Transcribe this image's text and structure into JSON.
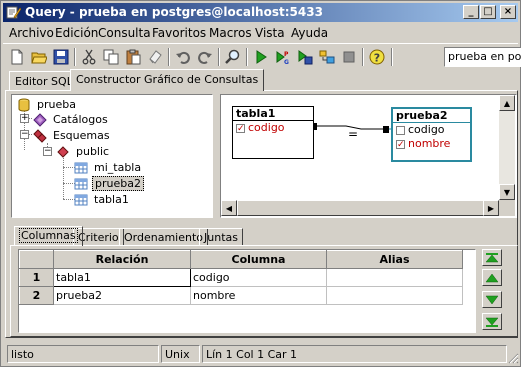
{
  "window": {
    "title": "Query - prueba en postgres@localhost:5433",
    "buttons": {
      "minimize": "_",
      "maximize": "□",
      "close": "×"
    }
  },
  "menu": [
    {
      "label": "Archivo",
      "hotkey": "A"
    },
    {
      "label": "Edición",
      "hotkey": "E"
    },
    {
      "label": "Consulta",
      "hotkey": "C"
    },
    {
      "label": "Favoritos",
      "hotkey": "F"
    },
    {
      "label": "Macros",
      "hotkey": "M"
    },
    {
      "label": "Vista",
      "hotkey": "V"
    },
    {
      "label": "Ayuda",
      "hotkey": "A"
    }
  ],
  "toolbar": {
    "icons": [
      "new-file-icon",
      "open-folder-icon",
      "save-icon",
      "cut-icon",
      "copy-icon",
      "paste-icon",
      "clear-icon",
      "undo-icon",
      "redo-icon",
      "find-icon",
      "execute-icon",
      "explain-icon",
      "execute-to-file-icon",
      "vacuum-icon",
      "stop-icon",
      "help-icon"
    ],
    "database_select": "prueba en post"
  },
  "main_tabs": [
    {
      "label": "Editor SQL",
      "active": false
    },
    {
      "label": "Constructor Gráfico de Consultas",
      "active": true
    }
  ],
  "tree": {
    "root": "prueba",
    "catalogs": "Catálogos",
    "schemas": "Esquemas",
    "schema": "public",
    "tables": [
      "mi_tabla",
      "prueba2",
      "tabla1"
    ],
    "selected": "prueba2"
  },
  "diagram": {
    "tables": [
      {
        "name": "tabla1",
        "fields": [
          {
            "name": "codigo",
            "checked": true
          }
        ]
      },
      {
        "name": "prueba2",
        "fields": [
          {
            "name": "codigo",
            "checked": false
          },
          {
            "name": "nombre",
            "checked": true
          }
        ]
      }
    ],
    "join_operator": "="
  },
  "bottom_tabs": [
    {
      "label": "Columnas",
      "active": true
    },
    {
      "label": "Criterio",
      "active": false
    },
    {
      "label": "Ordenamiento",
      "active": false
    },
    {
      "label": "Juntas",
      "active": false
    }
  ],
  "grid": {
    "headers": [
      "Relación",
      "Columna",
      "Alias"
    ],
    "rows": [
      {
        "num": "1",
        "relation": "tabla1",
        "column": "codigo",
        "alias": ""
      },
      {
        "num": "2",
        "relation": "prueba2",
        "column": "nombre",
        "alias": ""
      }
    ]
  },
  "status": {
    "message": "listo",
    "line_ending": "Unix",
    "position": "Lín 1 Col 1 Car 1"
  },
  "colors": {
    "title_start": "#0a246a",
    "title_end": "#a6caf0",
    "join_teal": "#2a8aa0"
  }
}
